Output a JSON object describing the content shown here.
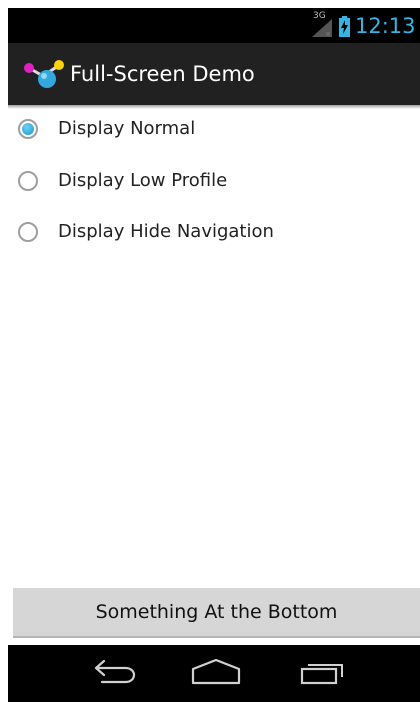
{
  "status_bar": {
    "network_label": "3G",
    "time": "12:13",
    "time_color": "#33b5e5",
    "icons": [
      "signal-icon",
      "battery-charging-icon"
    ]
  },
  "action_bar": {
    "title": "Full-Screen Demo",
    "app_icon": "molecule-app-icon"
  },
  "radio_group": {
    "options": [
      {
        "label": "Display Normal",
        "checked": true
      },
      {
        "label": "Display Low Profile",
        "checked": false
      },
      {
        "label": "Display Hide Navigation",
        "checked": false
      }
    ],
    "accent_color": "#33b5e5"
  },
  "bottom_button": {
    "label": "Something At the Bottom"
  },
  "nav_bar": {
    "buttons": [
      "back-icon",
      "home-icon",
      "recent-apps-icon"
    ]
  }
}
